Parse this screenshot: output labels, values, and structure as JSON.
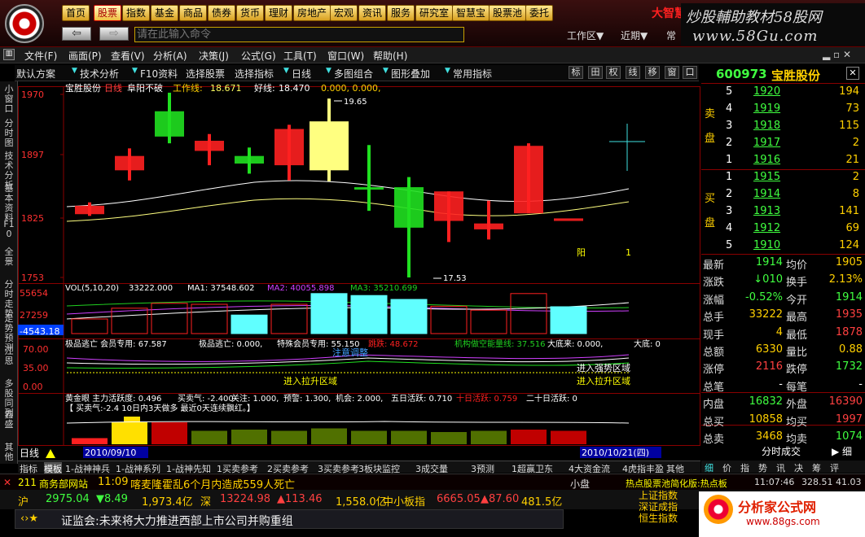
{
  "app": {
    "logo_text": "大智慧",
    "watermark": "炒股輔助教材58股网",
    "watermark_url": "www.58Gu.com"
  },
  "nav": [
    "首页",
    "股票",
    "指数",
    "基金",
    "商品",
    "债券",
    "货币",
    "理财",
    "房地产",
    "宏观",
    "资讯",
    "服务",
    "研究室",
    "智慧宝",
    "股票池",
    "委托"
  ],
  "nav_active": 1,
  "cmd": {
    "placeholder": "请在此输入命令"
  },
  "top_links": {
    "workarea": "工作区▼",
    "recent": "近期▼",
    "ext": "常"
  },
  "menu": [
    "文件(F)",
    "画面(P)",
    "查看(V)",
    "分析(A)",
    "决策(J)",
    "公式(G)",
    "工具(T)",
    "窗口(W)",
    "帮助(H)"
  ],
  "toolbar": [
    "默认方案",
    "技术分析",
    "F10资料",
    "选择股票",
    "选择指标",
    "日线",
    "多图组合",
    "图形叠加",
    "常用指标"
  ],
  "toolbar_icons": [
    "标",
    "田",
    "权",
    "线",
    "移",
    "窗",
    "口"
  ],
  "left_tabs": [
    "小窗口",
    "分时图",
    "技术分析",
    "基本资料",
    "F10",
    "全景",
    "分时走势",
    "走势预测",
    "江恩",
    "多股同列",
    "鑫盛",
    "其他"
  ],
  "chart": {
    "title": "宝胜股份",
    "period": "日线",
    "ind1": "阜阳不破",
    "work_line_label": "工作线:",
    "work_line_val": "18.671",
    "good_line_label": "好线:",
    "good_line_val": "18.470",
    "extra": "0.000, 0.000,",
    "y_labels": [
      "1970",
      "1897",
      "1825",
      "1753"
    ],
    "hi_label": "19.65",
    "lo_label": "17.53",
    "yang": "阳",
    "one": "1",
    "vol_line": "VOL(5,10,20)",
    "vol_val": "33222.000",
    "ma1": "MA1: 37548.602",
    "ma2": "MA2: 40055.898",
    "ma3": "MA3: 35210.699",
    "vol_y": [
      "55654",
      "27259",
      "-4543.18"
    ],
    "p3_line": "极品逃亡 会员专用: 67.587",
    "p3_items": [
      "极品逃亡: 0.000,",
      "特殊会员专用: 55.150",
      "跳跌: 48.672",
      "机构做空能量线: 37.516",
      "大底来: 0.000,",
      "大底: 0"
    ],
    "p3_y": [
      "70.00",
      "35.00",
      "0.00"
    ],
    "p3_notes": [
      "注意调整",
      "进入拉升区域",
      "进入强势区域",
      "进入拉升区域"
    ],
    "p4_line": "黄金眼 主力活跃度: 0.496",
    "p4_items": [
      "买卖气: -2.400",
      "关注: 1.000,",
      "预警: 1.300,",
      "机会: 2.000,",
      "五日活跃: 0.710",
      "十日活跃: 0.759",
      "二十日活跃: 0"
    ],
    "p4_line2": "【 买卖气:-2.4  10日内3天做多   最近0天连续飘红。】",
    "date_left": "2010/09/10",
    "date_right": "2010/10/21(四)",
    "dayline": "日线"
  },
  "candles": [
    {
      "o": 1838,
      "c": 1828,
      "h": 1842,
      "l": 1826,
      "col": "red"
    },
    {
      "o": 1897,
      "c": 1880,
      "h": 1906,
      "l": 1868,
      "col": "red"
    },
    {
      "o": 1920,
      "c": 1950,
      "h": 1972,
      "l": 1912,
      "col": "green"
    },
    {
      "o": 1915,
      "c": 1903,
      "h": 1923,
      "l": 1886,
      "col": "red"
    },
    {
      "o": 1888,
      "c": 1897,
      "h": 1907,
      "l": 1876,
      "col": "green"
    },
    {
      "o": 1929,
      "c": 1886,
      "h": 1934,
      "l": 1868,
      "col": "red"
    },
    {
      "o": 1938,
      "c": 1880,
      "h": 1965,
      "l": 1867,
      "col": "yellow"
    },
    {
      "o": 1860,
      "c": 1860,
      "h": 1910,
      "l": 1832,
      "col": "green"
    },
    {
      "o": 1860,
      "c": 1812,
      "h": 1872,
      "l": 1753,
      "col": "green"
    },
    {
      "o": 1855,
      "c": 1820,
      "h": 1855,
      "l": 1795,
      "col": "red"
    },
    {
      "o": 1817,
      "c": 1810,
      "h": 1844,
      "l": 1798,
      "col": "red"
    },
    {
      "o": 1909,
      "c": 1829,
      "h": 1912,
      "l": 1829,
      "col": "red"
    },
    {
      "o": 1823,
      "c": 1820,
      "h": 1820,
      "l": 1820,
      "col": "red"
    }
  ],
  "vols": [
    0.3,
    0.52,
    0.62,
    0.6,
    0.38,
    0.6,
    0.82,
    0.78,
    0.7,
    0.56,
    0.48,
    0.82,
    0.55
  ],
  "quote": {
    "code": "600973",
    "name": "宝胜股份",
    "sell_label": "卖 盘",
    "buy_label": "买 盘",
    "sells": [
      [
        "5",
        "1920",
        "194"
      ],
      [
        "4",
        "1919",
        "73"
      ],
      [
        "3",
        "1918",
        "115"
      ],
      [
        "2",
        "1917",
        "2"
      ],
      [
        "1",
        "1916",
        "21"
      ]
    ],
    "buys": [
      [
        "1",
        "1915",
        "2"
      ],
      [
        "2",
        "1914",
        "8"
      ],
      [
        "3",
        "1913",
        "141"
      ],
      [
        "4",
        "1912",
        "69"
      ],
      [
        "5",
        "1910",
        "124"
      ]
    ],
    "rows": [
      [
        "最新",
        "1914",
        "均价",
        "1905"
      ],
      [
        "涨跌",
        "↓010",
        "换手",
        "2.13%"
      ],
      [
        "涨幅",
        "-0.52%",
        "今开",
        "1914"
      ],
      [
        "总手",
        "33222",
        "最高",
        "1935"
      ],
      [
        "现手",
        "4",
        "最低",
        "1878"
      ],
      [
        "总额",
        "6330",
        "量比",
        "0.88"
      ],
      [
        "涨停",
        "2116",
        "跌停",
        "1732"
      ],
      [
        "总笔",
        "-",
        "每笔",
        "-"
      ],
      [
        "内盘",
        "16832",
        "外盘",
        "16390"
      ],
      [
        "总买",
        "10858",
        "均买",
        "1997"
      ],
      [
        "总卖",
        "3468",
        "均卖",
        "1074"
      ]
    ],
    "tab_title": "分时成交",
    "qtabs": [
      "细",
      "价",
      "指",
      "势",
      "讯",
      "决",
      "筹",
      "评"
    ]
  },
  "bottom_tabs": [
    "指标",
    "模板",
    "1-战神神兵",
    "1-战神系列",
    "1-战神先知",
    "1买卖参考",
    "2买卖参考",
    "3买卖参考",
    "3板块监控",
    "3成交量",
    "3预测",
    "1超赢卫东",
    "4大资金流",
    "4虎指丰盈",
    "其他"
  ],
  "news": {
    "num": "211",
    "site": "商务部网站",
    "time": "11:09",
    "text": "喀麦隆霍乱6个月内造成559人死亡",
    "slot": "小盘",
    "right": "热点股票池简化版:热点板",
    "ts": "11:07:46",
    "vals": "328.51 41.03"
  },
  "index": {
    "sh_label": "沪",
    "sh": "2975.04",
    "sh_chg": "8.49",
    "sh_amt": "1,973.4亿",
    "sz_label": "深",
    "sz": "13224.98",
    "sz_chg": "113.46",
    "sz_amt": "1,558.0亿",
    "zx_label": "中小板指",
    "zx": "6665.05",
    "zx_chg": "87.60",
    "zx_amt": "481.5亿"
  },
  "ticker": {
    "text": "证监会:未来将大力推进西部上市公司并购重组"
  },
  "right_idx": [
    "上证指数",
    "深证成指",
    "恒生指数"
  ],
  "rlogo": {
    "name": "分析家公式网",
    "url": "www.88gs.com"
  },
  "colors": {
    "red": "#ff2020",
    "green": "#20e020",
    "yellow": "#ffff80",
    "cyan": "#60ffff",
    "up": "#ff4040",
    "down": "#40ff40",
    "gold": "#ffd000"
  }
}
